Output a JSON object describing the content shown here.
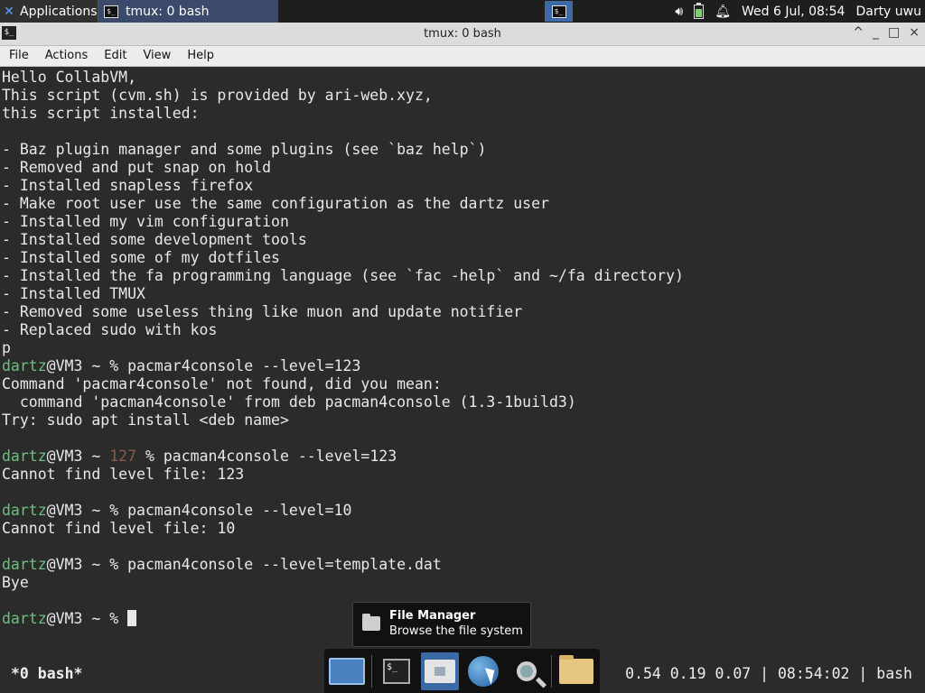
{
  "panel": {
    "apps_label": "Applications",
    "task_title": "tmux: 0 bash",
    "datetime": "Wed  6 Jul, 08:54",
    "user": "Darty uwu",
    "volume_icon": "volume-icon",
    "battery_icon": "battery-icon",
    "bell_icon": "bell-icon"
  },
  "window": {
    "title": "tmux: 0 bash",
    "controls": [
      "^",
      "_",
      "□",
      "×"
    ]
  },
  "menubar": [
    "File",
    "Actions",
    "Edit",
    "View",
    "Help"
  ],
  "terminal": {
    "lines": [
      "Hello CollabVM,",
      "This script (cvm.sh) is provided by ari-web.xyz,",
      "this script installed:",
      "",
      "- Baz plugin manager and some plugins (see `baz help`)",
      "- Removed and put snap on hold",
      "- Installed snapless firefox",
      "- Make root user use the same configuration as the dartz user",
      "- Installed my vim configuration",
      "- Installed some development tools",
      "- Installed some of my dotfiles",
      "- Installed the fa programming language (see `fac -help` and ~/fa directory)",
      "- Installed TMUX",
      "- Removed some useless thing like muon and update notifier",
      "- Replaced sudo with kos",
      "p"
    ],
    "prompt_user": "dartz",
    "prompt_host": "@VM3 ~ ",
    "session": [
      {
        "type": "prompt",
        "status": "",
        "cmd": "pacmar4console --level=123"
      },
      {
        "type": "out",
        "text": "Command 'pacmar4console' not found, did you mean:"
      },
      {
        "type": "out",
        "text": "  command 'pacman4console' from deb pacman4console (1.3-1build3)"
      },
      {
        "type": "out",
        "text": "Try: sudo apt install <deb name>"
      },
      {
        "type": "out",
        "text": ""
      },
      {
        "type": "prompt",
        "status": "127 ",
        "cmd": "pacman4console --level=123"
      },
      {
        "type": "out",
        "text": "Cannot find level file: 123"
      },
      {
        "type": "out",
        "text": ""
      },
      {
        "type": "prompt",
        "status": "",
        "cmd": "pacman4console --level=10"
      },
      {
        "type": "out",
        "text": "Cannot find level file: 10"
      },
      {
        "type": "out",
        "text": ""
      },
      {
        "type": "prompt",
        "status": "",
        "cmd": "pacman4console --level=template.dat"
      },
      {
        "type": "out",
        "text": "Bye"
      },
      {
        "type": "out",
        "text": ""
      },
      {
        "type": "prompt",
        "status": "",
        "cmd": "",
        "cursor": true
      }
    ]
  },
  "tooltip": {
    "title": "File Manager",
    "subtitle": "Browse the file system"
  },
  "tmux_status": {
    "window": "*0 bash*",
    "right": "0.54 0.19 0.07 | 08:54:02 | bash"
  },
  "dock": [
    "show-desktop-icon",
    "terminal-icon",
    "home-folder-icon",
    "web-browser-icon",
    "app-finder-icon",
    "files-icon"
  ]
}
